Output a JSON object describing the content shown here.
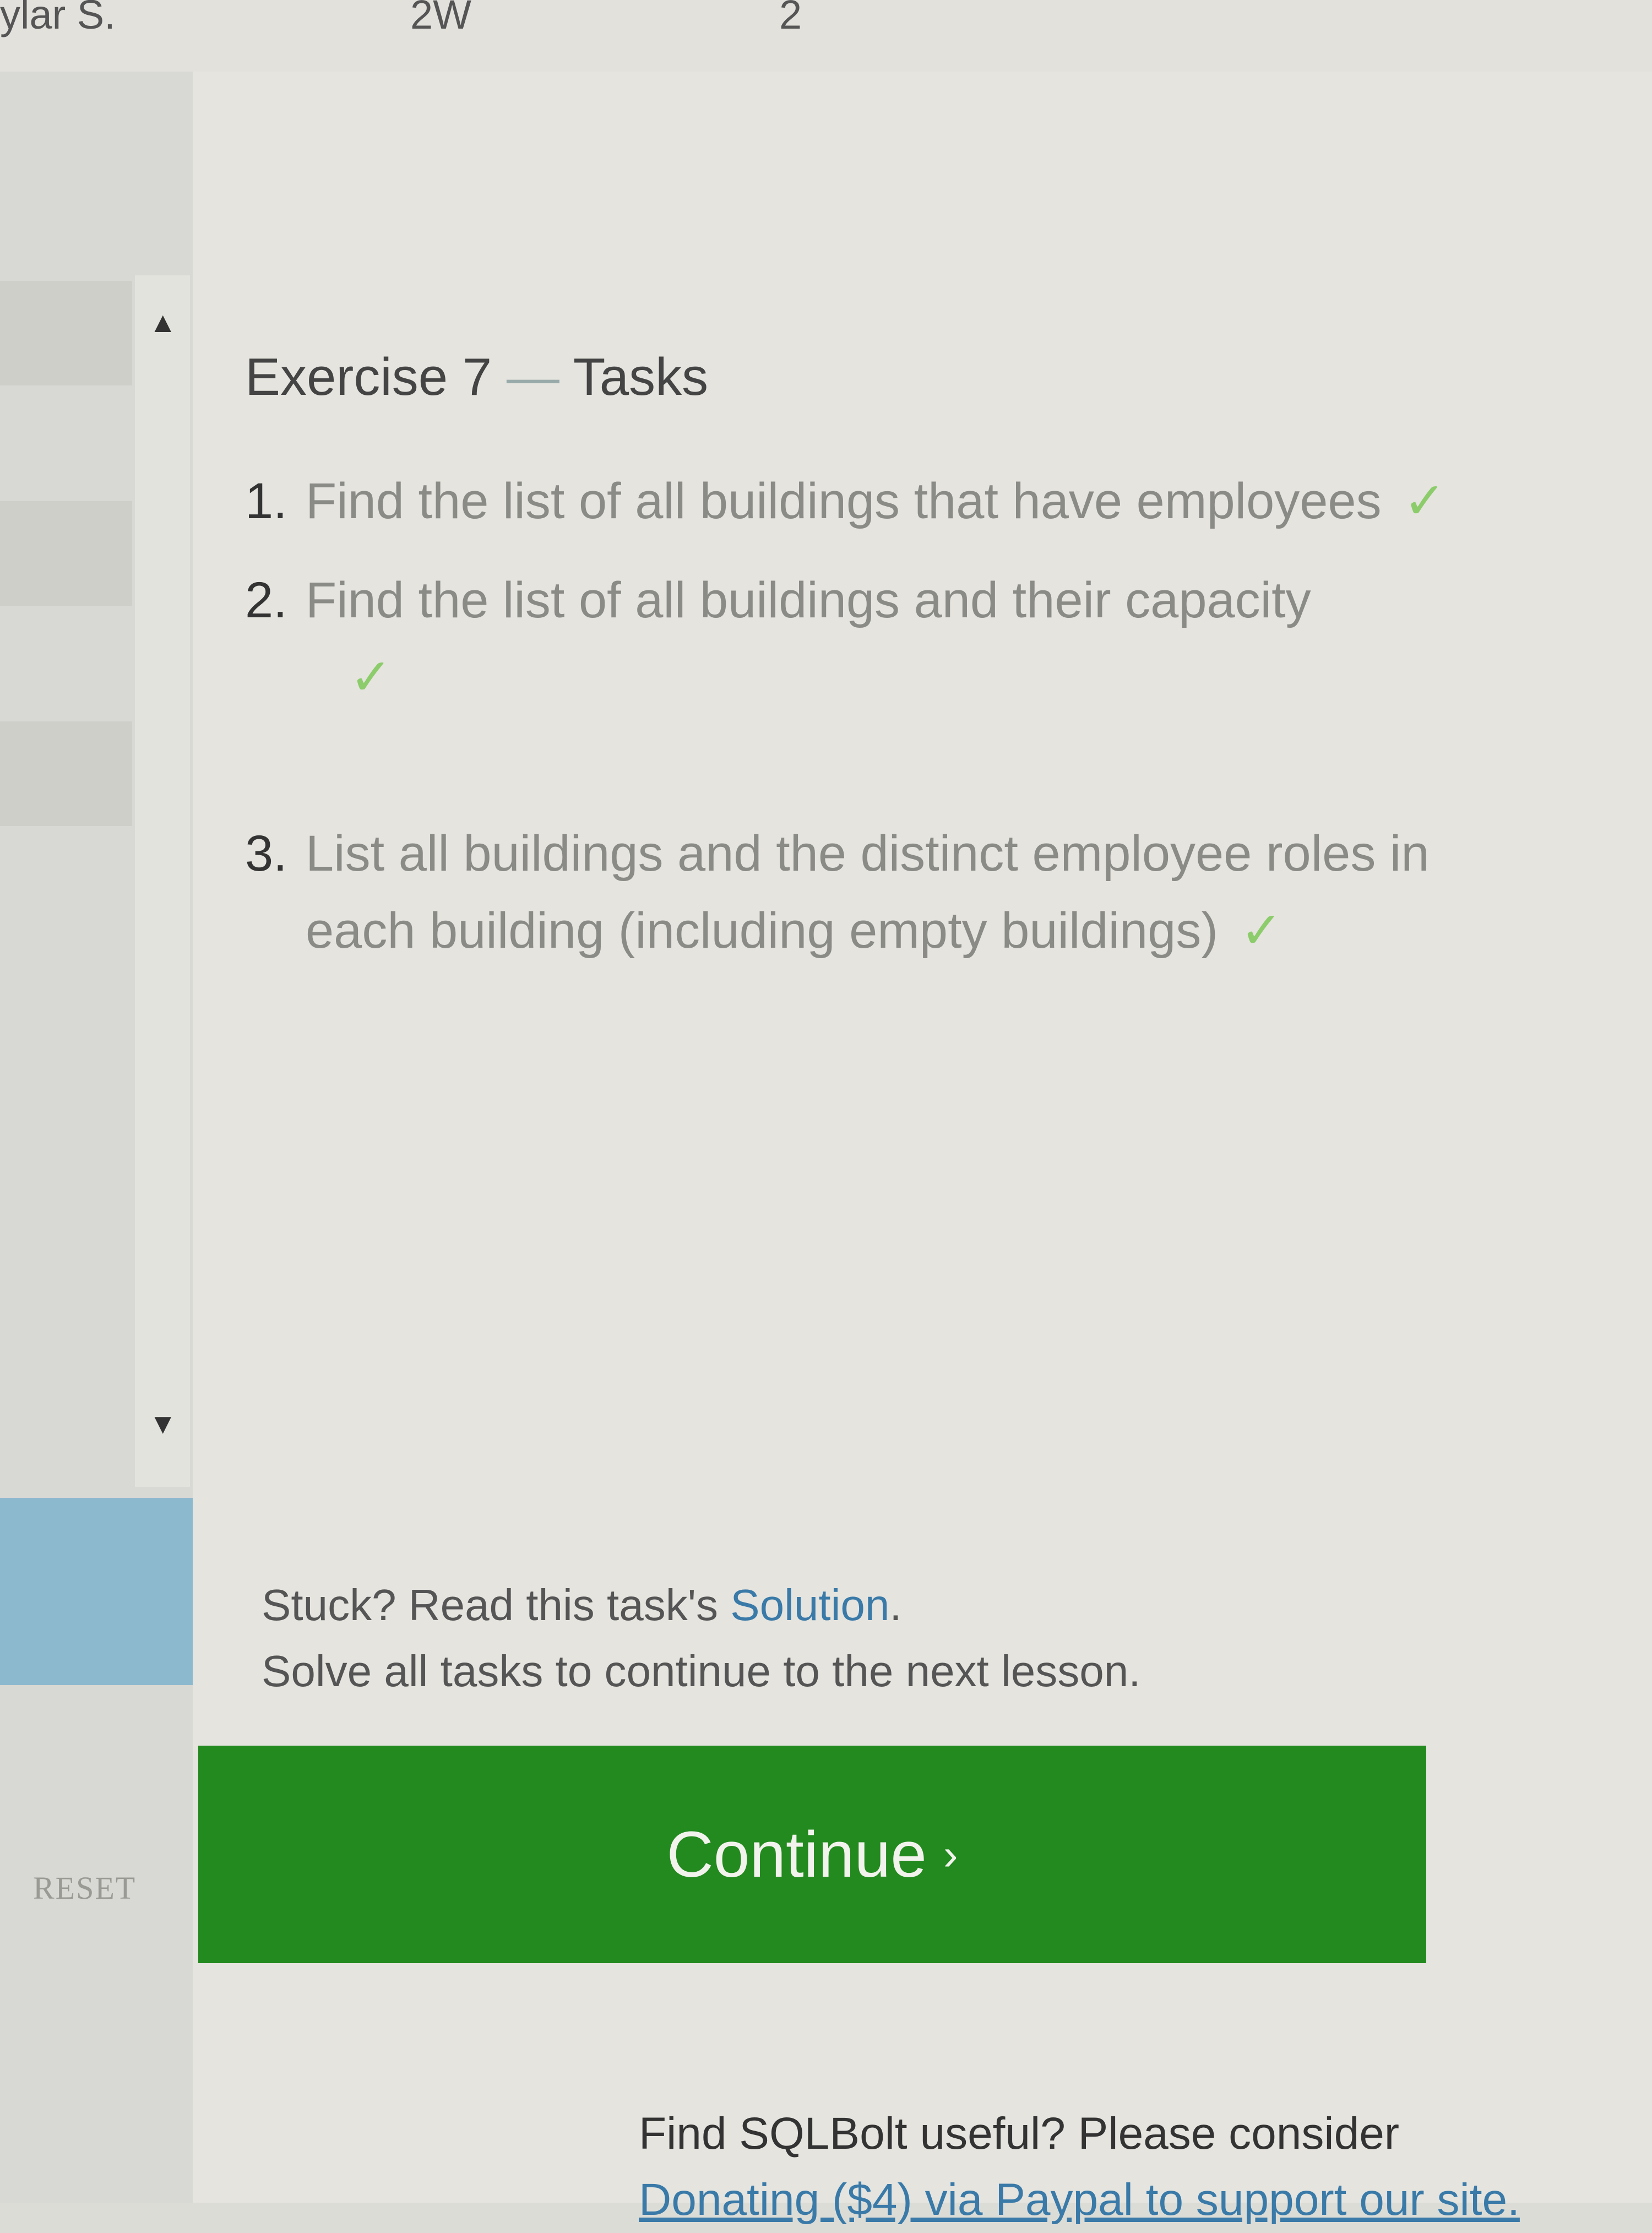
{
  "topbar": {
    "left_text": "ylar S.",
    "mid_text": "2W",
    "right_text": "2"
  },
  "exercise": {
    "title_main": "Exercise 7",
    "title_dash": "—",
    "title_tail": "Tasks"
  },
  "tasks": [
    {
      "num": "1.",
      "text": "Find the list of all buildings that have employees",
      "check": "✓"
    },
    {
      "num": "2.",
      "text": "Find the list of all buildings and their capacity",
      "check": "✓"
    },
    {
      "num": "3.",
      "text": "List all buildings and the distinct employee roles in each building (including empty buildings)",
      "check": "✓"
    }
  ],
  "help": {
    "stuck_prefix": "Stuck? Read this task's ",
    "solution_link": "Solution",
    "stuck_suffix": ".",
    "solve_all": "Solve all tasks to continue to the next lesson."
  },
  "buttons": {
    "continue_label": "Continue",
    "continue_chevron": "›",
    "reset_label": "RESET"
  },
  "icons": {
    "scroll_up": "▲",
    "scroll_down": "▼",
    "check": "check-icon",
    "chevron": "chevron-right-icon"
  },
  "footer": {
    "line1": "Find SQLBolt useful? Please consider",
    "line2": "Donating ($4) via Paypal to support our site."
  },
  "colors": {
    "continue_bg": "#228a1e",
    "link": "#3a7aa8",
    "check": "#8ccc6b",
    "sidebar_blue": "#8db9cf"
  }
}
